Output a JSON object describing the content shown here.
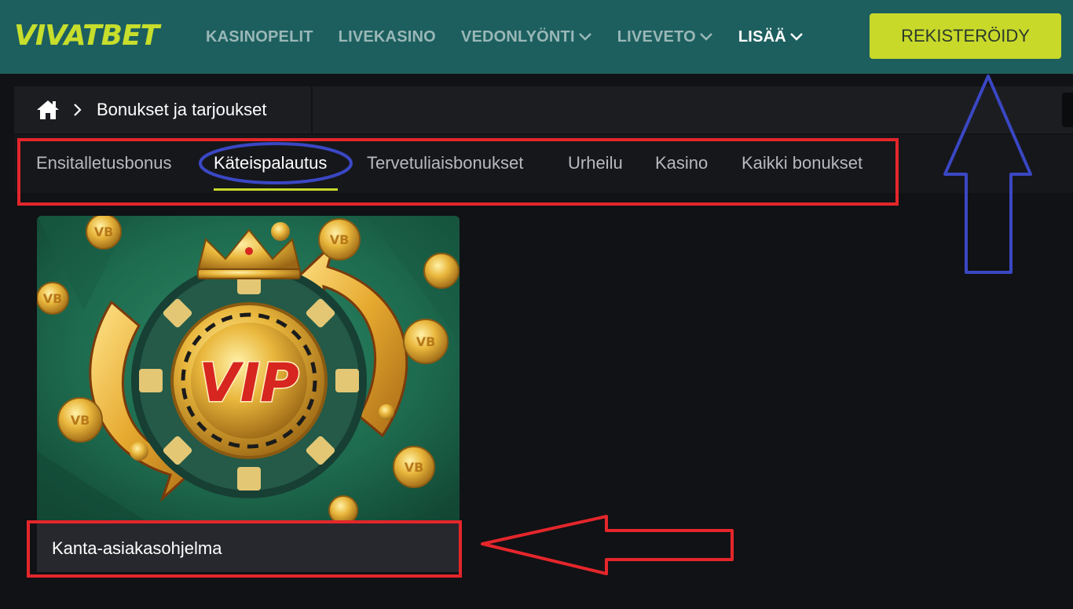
{
  "header": {
    "logo": "VIVATBET",
    "nav": [
      {
        "label": "KASINOPELIT",
        "has_dropdown": false
      },
      {
        "label": "LIVEKASINO",
        "has_dropdown": false
      },
      {
        "label": "VEDONLYÖNTI",
        "has_dropdown": true
      },
      {
        "label": "LIVEVETO",
        "has_dropdown": true
      },
      {
        "label": "LISÄÄ",
        "has_dropdown": true
      }
    ],
    "register_label": "REKISTERÖIDY"
  },
  "breadcrumb": {
    "home_icon": "home-icon",
    "current": "Bonukset ja tarjoukset"
  },
  "tabs": [
    {
      "label": "Ensitalletusbonus"
    },
    {
      "label": "Käteispalautus",
      "active": true
    },
    {
      "label": "Tervetuliaisbonukset"
    },
    {
      "label": "Urheilu"
    },
    {
      "label": "Kasino"
    },
    {
      "label": "Kaikki bonukset"
    }
  ],
  "card": {
    "image_text": "VIP",
    "coin_text": "VB",
    "title": "Kanta-asiakasohjelma"
  },
  "colors": {
    "header_bg": "#1d5f5f",
    "accent": "#c8d92a",
    "page_bg": "#111215",
    "annotation_red": "#e4262b",
    "annotation_blue": "#3a47c4"
  }
}
